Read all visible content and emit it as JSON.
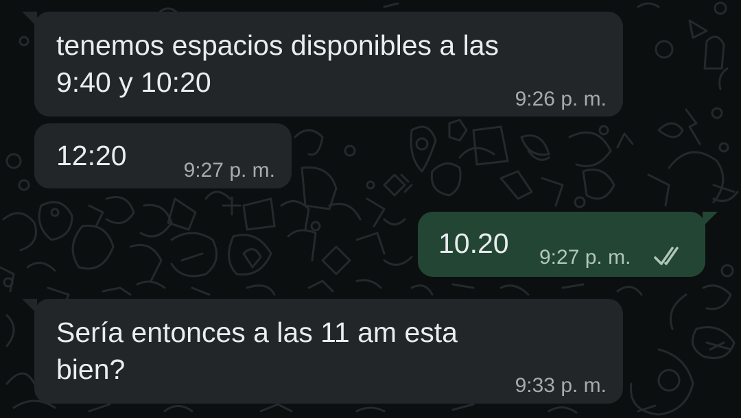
{
  "chat": {
    "messages": [
      {
        "direction": "incoming",
        "text": "tenemos espacios disponibles a las\n9:40 y 10:20",
        "time": "9:26 p. m."
      },
      {
        "direction": "incoming",
        "text": "12:20",
        "time": "9:27 p. m."
      },
      {
        "direction": "outgoing",
        "text": "10.20",
        "time": "9:27 p. m.",
        "status_icon": "double-check-icon",
        "status": "read"
      },
      {
        "direction": "incoming",
        "text": "Sería entonces a las 11 am esta\nbien?",
        "time": "9:33 p. m."
      }
    ]
  },
  "colors": {
    "background": "#0b0f10",
    "incoming_bubble": "#222628",
    "outgoing_bubble": "#234634",
    "text": "#e9edef",
    "timestamp": "#a6abae"
  }
}
